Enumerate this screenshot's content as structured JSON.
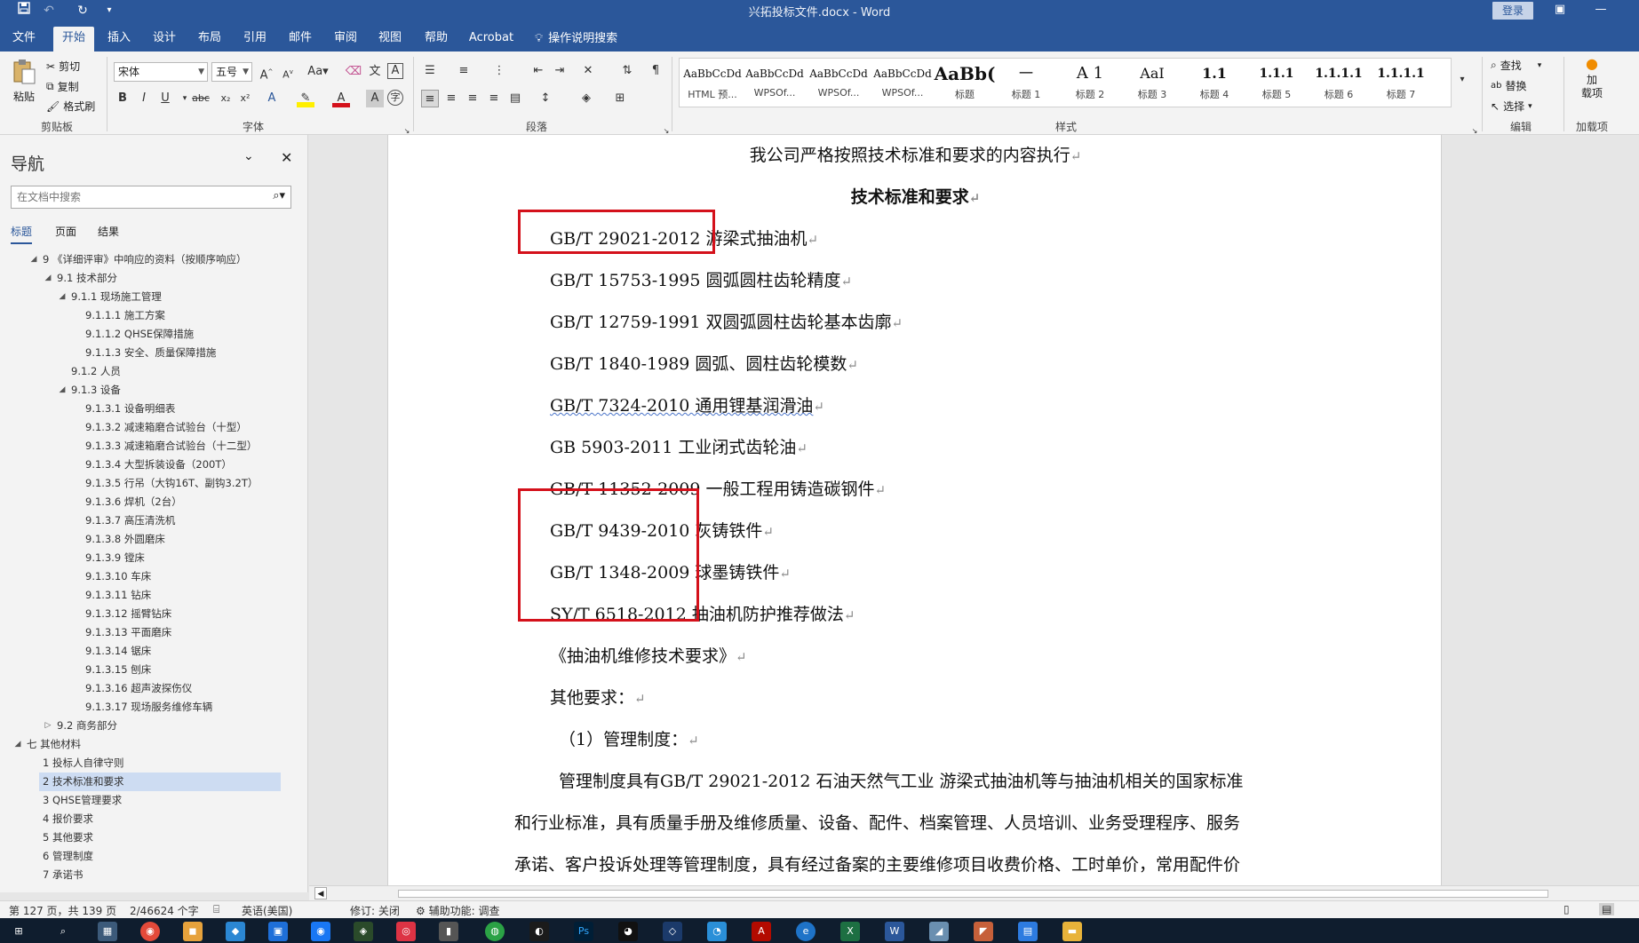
{
  "titlebar": {
    "doc_title": "兴拓投标文件.docx  -  Word",
    "login": "登录",
    "quick_access": [
      "save-icon",
      "undo-icon",
      "redo-icon",
      "customize-icon"
    ]
  },
  "ribbon_tabs": [
    "文件",
    "开始",
    "插入",
    "设计",
    "布局",
    "引用",
    "邮件",
    "审阅",
    "视图",
    "帮助",
    "Acrobat"
  ],
  "tell_me": "操作说明搜索",
  "clipboard": {
    "paste": "粘贴",
    "cut": "剪切",
    "copy": "复制",
    "format_painter": "格式刷",
    "label": "剪贴板"
  },
  "font": {
    "name": "宋体",
    "size": "五号",
    "label": "字体"
  },
  "paragraph": {
    "label": "段落"
  },
  "styles": {
    "label": "样式",
    "items": [
      {
        "sample": "AaBbCcDd",
        "name": "HTML 预..."
      },
      {
        "sample": "AaBbCcDd",
        "name": "WPSOf..."
      },
      {
        "sample": "AaBbCcDd",
        "name": "WPSOf..."
      },
      {
        "sample": "AaBbCcDd",
        "name": "WPSOf..."
      },
      {
        "sample": "AaBb(",
        "name": "标题"
      },
      {
        "sample": "一",
        "name": "标题 1"
      },
      {
        "sample": "A 1",
        "name": "标题 2"
      },
      {
        "sample": "AaI",
        "name": "标题 3"
      },
      {
        "sample": "1.1",
        "name": "标题 4"
      },
      {
        "sample": "1.1.1",
        "name": "标题 5"
      },
      {
        "sample": "1.1.1.1",
        "name": "标题 6"
      },
      {
        "sample": "1.1.1.1",
        "name": "标题 7"
      },
      {
        "sample": "1.1.1.1",
        "name": "标题 7"
      }
    ]
  },
  "editing": {
    "find": "查找",
    "replace": "替换",
    "select": "选择",
    "label": "编辑"
  },
  "addins": {
    "button": "加\n载项",
    "label": "加载项"
  },
  "nav": {
    "title": "导航",
    "search_placeholder": "在文档中搜索",
    "tabs": [
      "标题",
      "页面",
      "结果"
    ],
    "outline": [
      {
        "text": "9 《详细评审》中响应的资料（按顺序响应）",
        "level": 1,
        "caret": "down"
      },
      {
        "text": "9.1 技术部分",
        "level": 2,
        "caret": "down"
      },
      {
        "text": "9.1.1 现场施工管理",
        "level": 3,
        "caret": "down"
      },
      {
        "text": "9.1.1.1 施工方案",
        "level": 4
      },
      {
        "text": "9.1.1.2 QHSE保障措施",
        "level": 4
      },
      {
        "text": "9.1.1.3 安全、质量保障措施",
        "level": 4
      },
      {
        "text": "9.1.2 人员",
        "level": 3
      },
      {
        "text": "9.1.3 设备",
        "level": 3,
        "caret": "down"
      },
      {
        "text": "9.1.3.1 设备明细表",
        "level": 4
      },
      {
        "text": "9.1.3.2 减速箱磨合试验台（十型）",
        "level": 4
      },
      {
        "text": "9.1.3.3 减速箱磨合试验台（十二型）",
        "level": 4
      },
      {
        "text": "9.1.3.4 大型拆装设备（200T）",
        "level": 4
      },
      {
        "text": "9.1.3.5 行吊（大钩16T、副钩3.2T）",
        "level": 4
      },
      {
        "text": "9.1.3.6 焊机（2台）",
        "level": 4
      },
      {
        "text": "9.1.3.7 高压清洗机",
        "level": 4
      },
      {
        "text": "9.1.3.8 外圆磨床",
        "level": 4
      },
      {
        "text": "9.1.3.9 镗床",
        "level": 4
      },
      {
        "text": "9.1.3.10 车床",
        "level": 4
      },
      {
        "text": "9.1.3.11 钻床",
        "level": 4
      },
      {
        "text": "9.1.3.12 摇臂钻床",
        "level": 4
      },
      {
        "text": "9.1.3.13 平面磨床",
        "level": 4
      },
      {
        "text": "9.1.3.14 锯床",
        "level": 4
      },
      {
        "text": "9.1.3.15 刨床",
        "level": 4
      },
      {
        "text": "9.1.3.16 超声波探伤仪",
        "level": 4
      },
      {
        "text": "9.1.3.17 现场服务维修车辆",
        "level": 4
      },
      {
        "text": "9.2 商务部分",
        "level": 2,
        "caret": "right"
      },
      {
        "text": "七 其他材料",
        "level": 0,
        "caret": "down"
      },
      {
        "text": "1 投标人自律守则",
        "level": 1
      },
      {
        "text": "2 技术标准和要求",
        "level": 1,
        "selected": true
      },
      {
        "text": "3 QHSE管理要求",
        "level": 1
      },
      {
        "text": "4 报价要求",
        "level": 1
      },
      {
        "text": "5 其他要求",
        "level": 1
      },
      {
        "text": "6 管理制度",
        "level": 1
      },
      {
        "text": "7 承诺书",
        "level": 1
      }
    ]
  },
  "document": {
    "lines": [
      {
        "text": "我公司严格按照技术标准和要求的内容执行",
        "style": "center"
      },
      {
        "text": "技术标准和要求",
        "style": "center-bold"
      },
      {
        "text": "GB/T 29021-2012 游梁式抽油机",
        "style": "indent"
      },
      {
        "text": "GB/T 15753-1995 圆弧圆柱齿轮精度",
        "style": "indent"
      },
      {
        "text": "GB/T 12759-1991 双圆弧圆柱齿轮基本齿廓",
        "style": "indent"
      },
      {
        "text": "GB/T 1840-1989 圆弧、圆柱齿轮模数",
        "style": "indent"
      },
      {
        "text": "GB/T 7324-2010 通用锂基润滑油",
        "style": "indent"
      },
      {
        "text": "GB 5903-2011 工业闭式齿轮油",
        "style": "indent"
      },
      {
        "text": "GB/T 11352-2009 一般工程用铸造碳钢件",
        "style": "indent"
      },
      {
        "text": "GB/T 9439-2010 灰铸铁件",
        "style": "indent"
      },
      {
        "text": "GB/T 1348-2009 球墨铸铁件",
        "style": "indent"
      },
      {
        "text": "SY/T 6518-2012 抽油机防护推荐做法",
        "style": "indent"
      },
      {
        "text": "《抽油机维修技术要求》",
        "style": "indent"
      },
      {
        "text": "其他要求：",
        "style": "indent"
      },
      {
        "text": "（1）管理制度：",
        "style": "indent2"
      },
      {
        "text": "管理制度具有GB/T 29021-2012 石油天然气工业 游梁式抽油机等与抽油机相关的国家标准",
        "style": "indent2"
      },
      {
        "text": "和行业标准，具有质量手册及维修质量、设备、配件、档案管理、人员培训、业务受理程序、服务",
        "style": "body"
      },
      {
        "text": "承诺、客户投诉处理等管理制度，具有经过备案的主要维修项目收费价格、工时单价，常用配件价",
        "style": "body"
      }
    ],
    "paragraph_mark": "↵"
  },
  "statusbar": {
    "page": "第 127 页，共 139 页",
    "words": "2/46624 个字",
    "language": "英语(美国)",
    "track_changes": "修订: 关闭",
    "accessibility": "辅助功能: 调查"
  },
  "colors": {
    "word_blue": "#2b579a",
    "highlight_box": "#d4111b",
    "selected_outline": "#cddcf2"
  }
}
